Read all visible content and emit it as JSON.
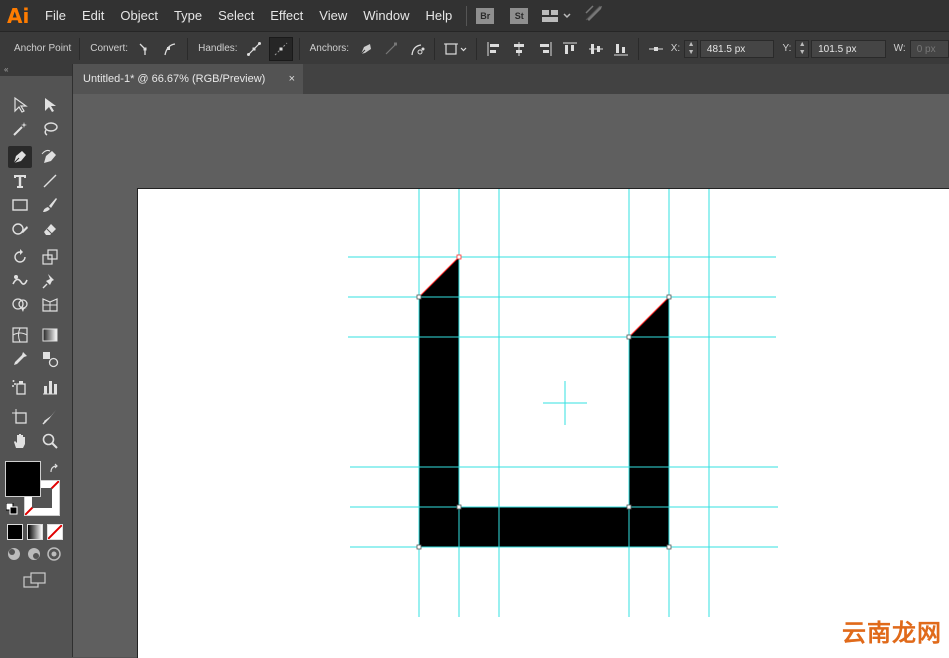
{
  "app": {
    "logo": "Ai"
  },
  "menu": {
    "items": [
      "File",
      "Edit",
      "Object",
      "Type",
      "Select",
      "Effect",
      "View",
      "Window",
      "Help"
    ],
    "bridge": "Br",
    "stock": "St"
  },
  "control_bar": {
    "tool_name": "Anchor Point",
    "convert_label": "Convert:",
    "handles_label": "Handles:",
    "anchors_label": "Anchors:",
    "x_label": "X:",
    "x_value": "481.5 px",
    "y_label": "Y:",
    "y_value": "101.5 px",
    "w_label": "W:",
    "w_value": "0 px"
  },
  "tools_panel": {
    "collapse_glyph": "«"
  },
  "document": {
    "tab_title": "Untitled-1* @ 66.67% (RGB/Preview)",
    "close_glyph": "×"
  },
  "colors": {
    "menubar": "#323232",
    "guide": "#33e0e0",
    "fill": "#000000",
    "path_highlight": "#ff3030",
    "brand": "#ff7c00"
  },
  "watermark": "云南龙网"
}
